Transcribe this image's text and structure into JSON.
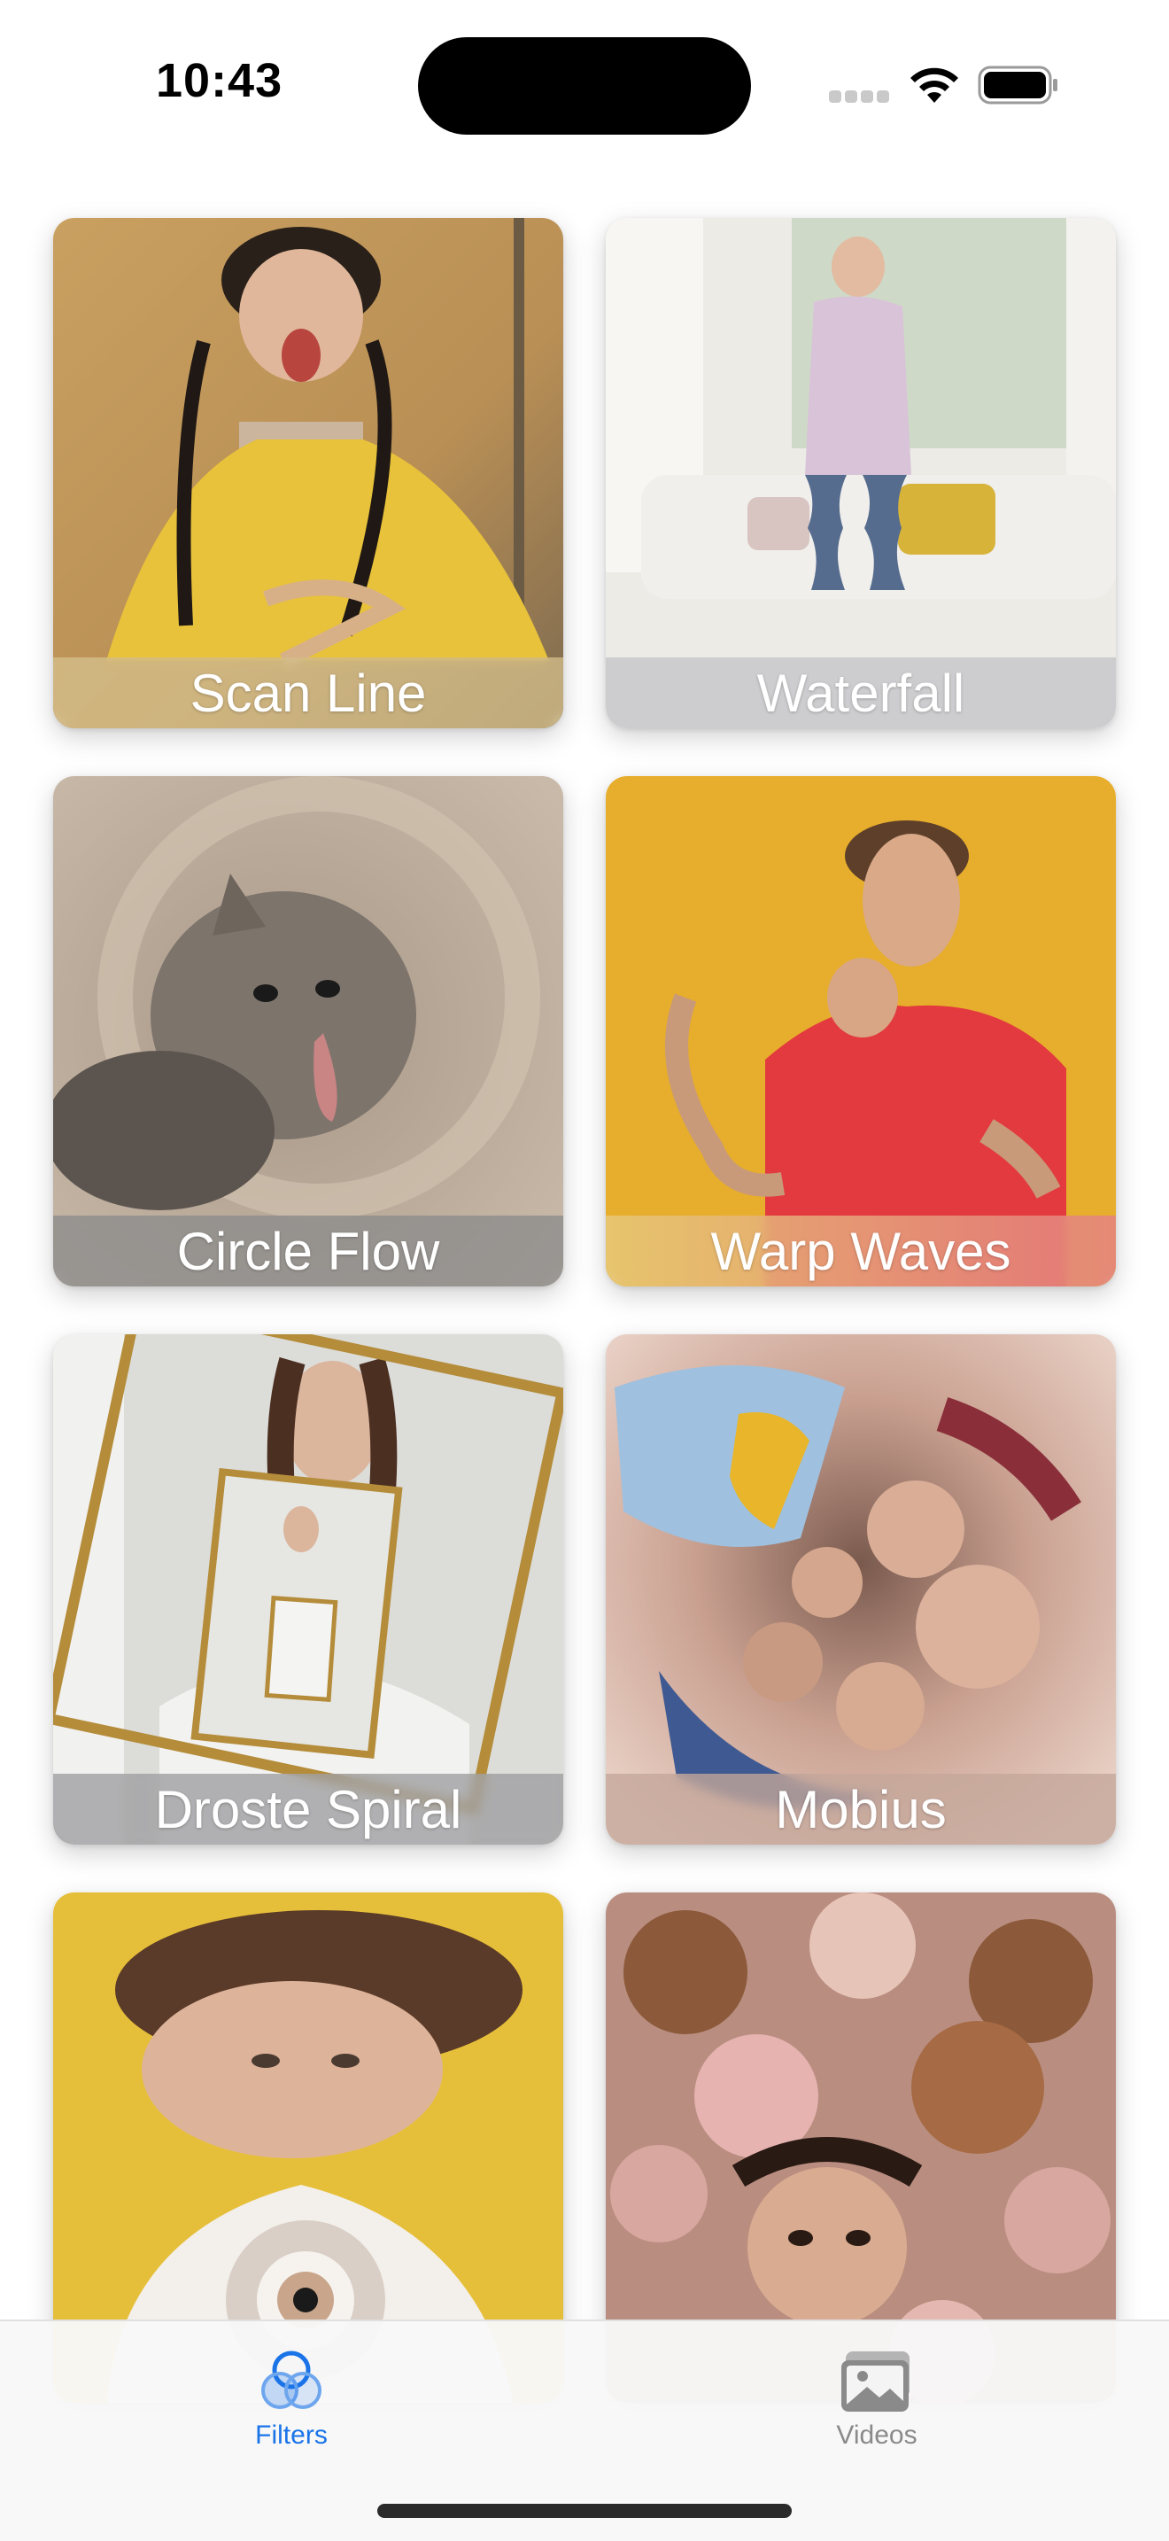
{
  "status_bar": {
    "time": "10:43",
    "icons": [
      "cellular-signal-icon",
      "wifi-icon",
      "battery-icon"
    ]
  },
  "filters": [
    {
      "label": "Scan Line",
      "tint": "#d9c48e"
    },
    {
      "label": "Waterfall",
      "tint": "#c8c8cc"
    },
    {
      "label": "Circle Flow",
      "tint": "#8e8e8e"
    },
    {
      "label": "Warp Waves",
      "tint": "#e8b07c"
    },
    {
      "label": "Droste Spiral",
      "tint": "#9a9a9c"
    },
    {
      "label": "Mobius",
      "tint": "#c9aba0"
    },
    {
      "label": "",
      "tint": "#e6bf3a"
    },
    {
      "label": "",
      "tint": "#c79a94"
    }
  ],
  "tab_bar": {
    "tabs": [
      {
        "label": "Filters",
        "icon": "filters-icon",
        "selected": true
      },
      {
        "label": "Videos",
        "icon": "photo-stack-icon",
        "selected": false
      }
    ],
    "accent_color": "#1a74e8",
    "inactive_color": "#8a8a8a"
  }
}
